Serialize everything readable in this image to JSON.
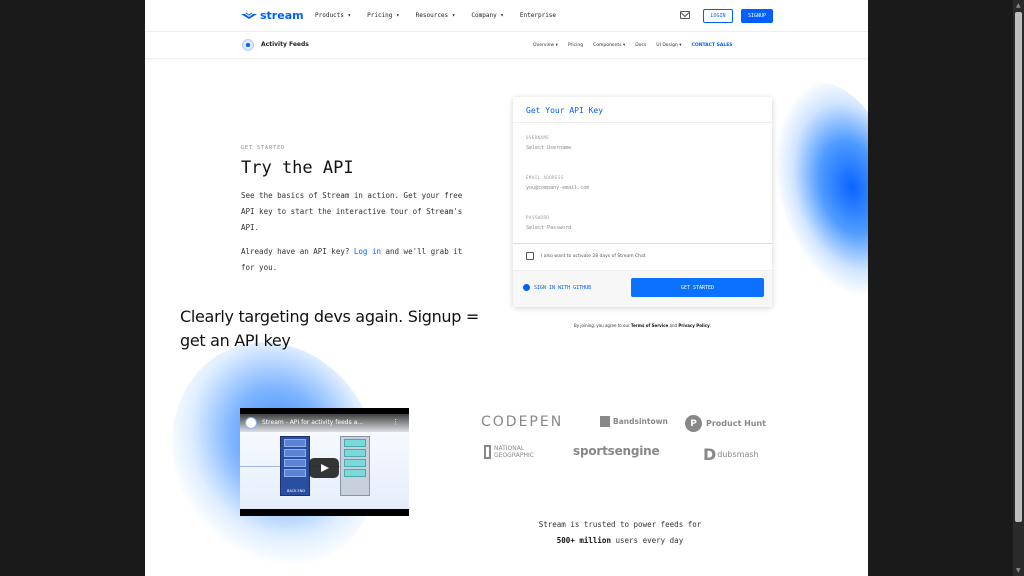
{
  "nav": {
    "logo_text": "stream",
    "items": [
      "Products ▾",
      "Pricing ▾",
      "Resources ▾",
      "Company ▾",
      "Enterprise"
    ],
    "login": "LOGIN",
    "signup": "SIGNUP"
  },
  "subnav": {
    "title": "Activity Feeds",
    "items": [
      "Overview ▾",
      "Pricing",
      "Components ▾",
      "Docs",
      "UI Design ▾"
    ],
    "contact": "CONTACT SALES"
  },
  "hero": {
    "eyebrow": "GET STARTED",
    "title": "Try the API",
    "p1": "See the basics of Stream in action. Get your free API key to start the interactive tour of Stream's API.",
    "p2_before": "Already have an API key? ",
    "p2_link": "Log in",
    "p2_after": " and we'll grab it for you."
  },
  "annotation": "Clearly targeting devs again. Signup = get an API key",
  "form": {
    "heading": "Get Your API Key",
    "username_label": "USERNAME",
    "username_placeholder": "Select Username",
    "email_label": "EMAIL ADDRESS",
    "email_placeholder": "you@company-email.com",
    "password_label": "PASSWORD",
    "password_placeholder": "Select Password",
    "checkbox_label": "I also want to activate 28 days of Stream Chat",
    "github": "SIGN IN WITH GITHUB",
    "submit": "GET STARTED",
    "terms_before": "By joining, you agree to our ",
    "terms_link": "Terms of Service",
    "terms_mid": " and ",
    "privacy_link": "Privacy Policy",
    "terms_after": "."
  },
  "video": {
    "title": "Stream - API for activity feeds a...",
    "server_label": "BACK END"
  },
  "logos": {
    "codepen": "CODEPEN",
    "bandsintown": "Bandsintown",
    "producthunt": "Product Hunt",
    "natgeo_line1": "NATIONAL",
    "natgeo_line2": "GEOGRAPHIC",
    "sportsengine": "sportsengine",
    "dubsmash": "dubsmash"
  },
  "trust": {
    "line1": "Stream is trusted to power feeds for",
    "bold": "500+ million",
    "line2_after": " users every day"
  }
}
